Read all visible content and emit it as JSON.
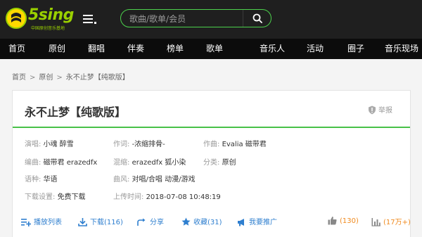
{
  "logo": {
    "text": "5sing",
    "subtitle": "中国原创音乐基地"
  },
  "search": {
    "placeholder": "歌曲/歌单/会员"
  },
  "nav": [
    "首页",
    "原创",
    "翻唱",
    "伴奏",
    "榜单",
    "歌单",
    "音乐人",
    "活动",
    "圈子",
    "音乐现场"
  ],
  "breadcrumb": [
    "首页",
    ">",
    "原创",
    ">",
    "永不止梦【纯歌版】"
  ],
  "song": {
    "title": "永不止梦【纯歌版】",
    "report_label": "举报"
  },
  "info": {
    "singer_k": "演唱:",
    "singer_v": "小魂 醉雪",
    "lyric_k": "作词:",
    "lyric_v": "-浓缩排骨-",
    "compose_k": "作曲:",
    "compose_v": "Evalia 磁带君",
    "arrange_k": "编曲:",
    "arrange_v": "磁带君 erazedfx",
    "mix_k": "混缩:",
    "mix_v": "erazedfx 狐小染",
    "category_k": "分类:",
    "category_v": "原创",
    "lang_k": "语种:",
    "lang_v": "华语",
    "style_k": "曲风:",
    "style_v": "对唱/合唱 动漫/游戏",
    "download_k": "下载设置:",
    "download_v": "免费下载",
    "upload_k": "上传时间:",
    "upload_v": "2018-07-08 10:48:19"
  },
  "actions": {
    "playlist": "播放列表",
    "download": "下载(116)",
    "share": "分享",
    "favorite": "收藏(31)",
    "promote": "我要推广",
    "like": "(130)",
    "plays": "(17万+)"
  },
  "colors": {
    "accent_green": "#48c148",
    "link_blue": "#2f7fcf",
    "orange": "#f08a1e"
  }
}
